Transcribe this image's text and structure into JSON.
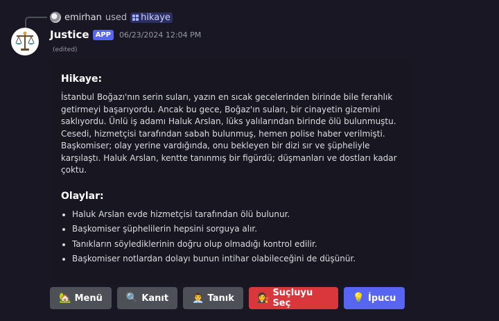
{
  "reply": {
    "user": "emirhan",
    "used_text": "used",
    "command": "hikaye"
  },
  "message": {
    "username": "Justice",
    "badge": "APP",
    "timestamp": "06/23/2024 12:04 PM",
    "edited": "(edited)"
  },
  "embed": {
    "title": "Hikaye:",
    "story": "İstanbul Boğazı'nın serin suları, yazın en sıcak gecelerinden birinde bile ferahlık getirmeyi başarıyordu. Ancak bu gece, Boğaz'ın suları, bir cinayetin gizemini saklıyordu. Ünlü iş adamı Haluk Arslan, lüks yalılarından birinde ölü bulunmuştu. Cesedi, hizmetçisi tarafından sabah bulunmuş, hemen polise haber verilmişti. Başkomiser; olay yerine vardığında, onu bekleyen bir dizi sır ve şüpheliyle karşılaştı. Haluk Arslan, kentte tanınmış bir figürdü; düşmanları ve dostları kadar çoktu.",
    "events_title": "Olaylar:",
    "events": [
      "Haluk Arslan evde hizmetçisi tarafından ölü bulunur.",
      "Başkomiser şüphelilerin hepsini sorguya alır.",
      "Tanıkların söylediklerinin doğru olup olmadığı kontrol edilir.",
      "Başkomiser notlardan dolayı bunun intihar olabileceğini de düşünür."
    ]
  },
  "buttons": [
    {
      "label": "Menü",
      "emoji": "🏡",
      "icon": "house-icon",
      "color": "#4e5058"
    },
    {
      "label": "Kanıt",
      "emoji": "🔍",
      "icon": "magnifier-icon",
      "color": "#4e5058"
    },
    {
      "label": "Tanık",
      "emoji": "👨‍💼",
      "icon": "person-icon",
      "color": "#4e5058"
    },
    {
      "label": "Suçluyu Seç",
      "emoji": "🧑‍⚖️",
      "icon": "judge-icon",
      "color": "#da373c"
    },
    {
      "label": "İpucu",
      "emoji": "💡",
      "icon": "lightbulb-icon",
      "color": "#5865f2"
    }
  ]
}
